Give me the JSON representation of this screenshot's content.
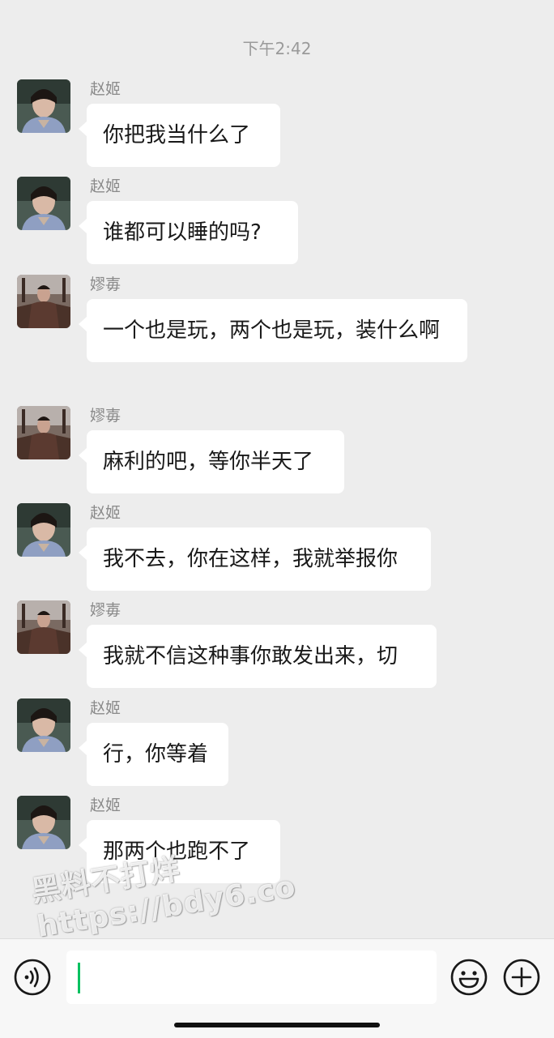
{
  "timestamp": "下午2:42",
  "messages": [
    {
      "sender": "赵姬",
      "text": "你把我当什么了"
    },
    {
      "sender": "赵姬",
      "text": "谁都可以睡的吗?"
    },
    {
      "sender": "嫪毐",
      "text": "一个也是玩，两个也是玩，装什么啊"
    },
    {
      "sender": "嫪毐",
      "text": "麻利的吧，等你半天了"
    },
    {
      "sender": "赵姬",
      "text": "我不去，你在这样，我就举报你"
    },
    {
      "sender": "嫪毐",
      "text": "我就不信这种事你敢发出来，切"
    },
    {
      "sender": "赵姬",
      "text": "行，你等着"
    },
    {
      "sender": "赵姬",
      "text": "那两个也跑不了"
    }
  ],
  "watermark": {
    "line1": "黑料不打烊",
    "line2": "https://bdy6.co"
  },
  "input_bar": {
    "voice_icon": "voice-icon",
    "emoji_icon": "emoji-icon",
    "plus_icon": "plus-icon"
  },
  "colors": {
    "background": "#ededed",
    "bubble": "#ffffff",
    "caret": "#07c160",
    "sender_text": "#8a8a8a"
  }
}
